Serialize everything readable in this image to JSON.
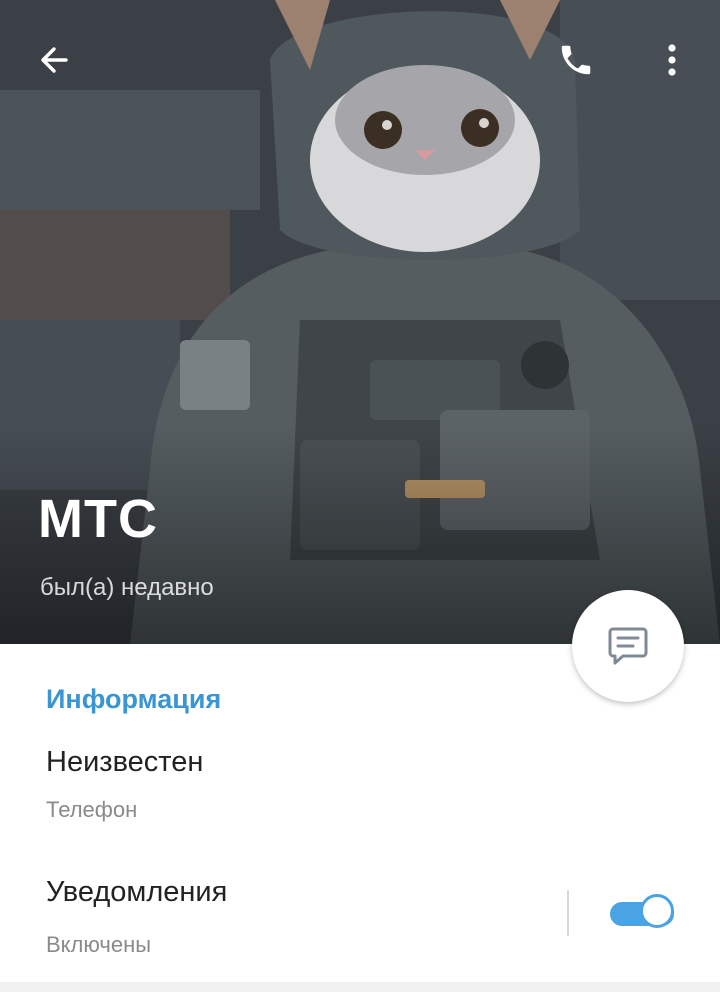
{
  "header": {
    "name": "МТС",
    "status": "был(а) недавно",
    "back_icon": "arrow-left-icon",
    "call_icon": "phone-icon",
    "more_icon": "more-vertical-icon"
  },
  "fab": {
    "icon": "message-icon"
  },
  "info": {
    "section_title": "Информация",
    "phone": {
      "value": "Неизвестен",
      "label": "Телефон"
    },
    "notifications": {
      "value": "Уведомления",
      "label": "Включены",
      "enabled": true
    }
  },
  "colors": {
    "accent": "#3a95d5",
    "toggle": "#4aa3e3"
  }
}
